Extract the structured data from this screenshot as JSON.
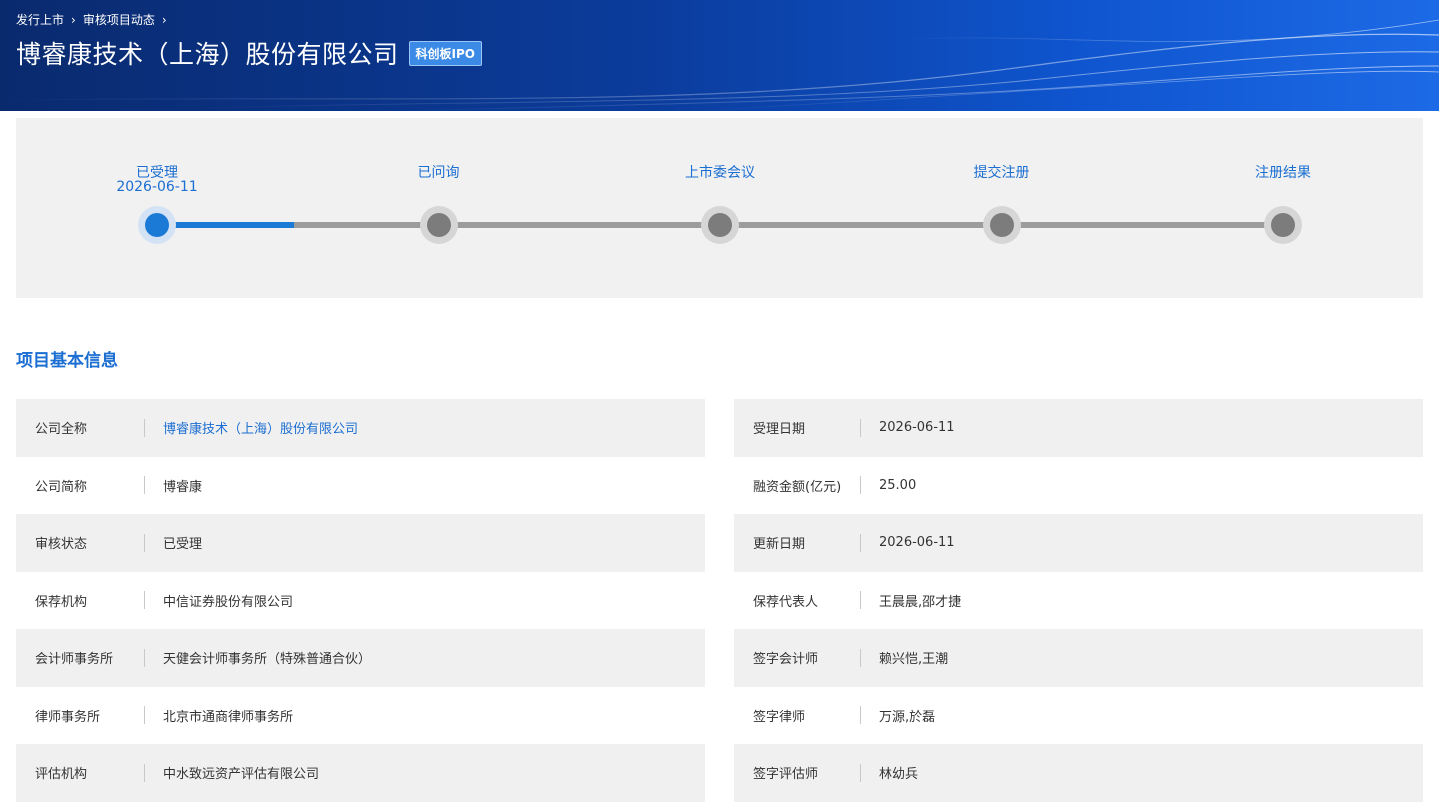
{
  "breadcrumb": [
    "发行上市",
    "审核项目动态"
  ],
  "header": {
    "company_title": "博睿康技术（上海）股份有限公司",
    "board_tag": "科创板IPO"
  },
  "colors": {
    "accent": "#1b6ed2",
    "banner_dark": "#0a2a6e",
    "inactive_dot": "#7c7c7c"
  },
  "progress": {
    "current_step": 0,
    "done_fraction": 0.12,
    "steps": [
      {
        "label": "已受理",
        "date": "2026-06-11"
      },
      {
        "label": "已问询",
        "date": ""
      },
      {
        "label": "上市委会议",
        "date": ""
      },
      {
        "label": "提交注册",
        "date": ""
      },
      {
        "label": "注册结果",
        "date": ""
      }
    ]
  },
  "info": {
    "title": "项目基本信息",
    "left": [
      {
        "label": "公司全称",
        "value": "博睿康技术（上海）股份有限公司"
      },
      {
        "label": "公司简称",
        "value": "博睿康"
      },
      {
        "label": "审核状态",
        "value": "已受理"
      },
      {
        "label": "保荐机构",
        "value": "中信证券股份有限公司"
      },
      {
        "label": "会计师事务所",
        "value": "天健会计师事务所（特殊普通合伙）"
      },
      {
        "label": "律师事务所",
        "value": "北京市通商律师事务所"
      },
      {
        "label": "评估机构",
        "value": "中水致远资产评估有限公司"
      }
    ],
    "right": [
      {
        "label": "受理日期",
        "value": "2026-06-11"
      },
      {
        "label": "融资金额(亿元)",
        "value": "25.00"
      },
      {
        "label": "更新日期",
        "value": "2026-06-11"
      },
      {
        "label": "保荐代表人",
        "value": "王晨晨,邵才捷"
      },
      {
        "label": "签字会计师",
        "value": "赖兴恺,王潮"
      },
      {
        "label": "签字律师",
        "value": "万源,於磊"
      },
      {
        "label": "签字评估师",
        "value": "林幼兵"
      }
    ]
  }
}
